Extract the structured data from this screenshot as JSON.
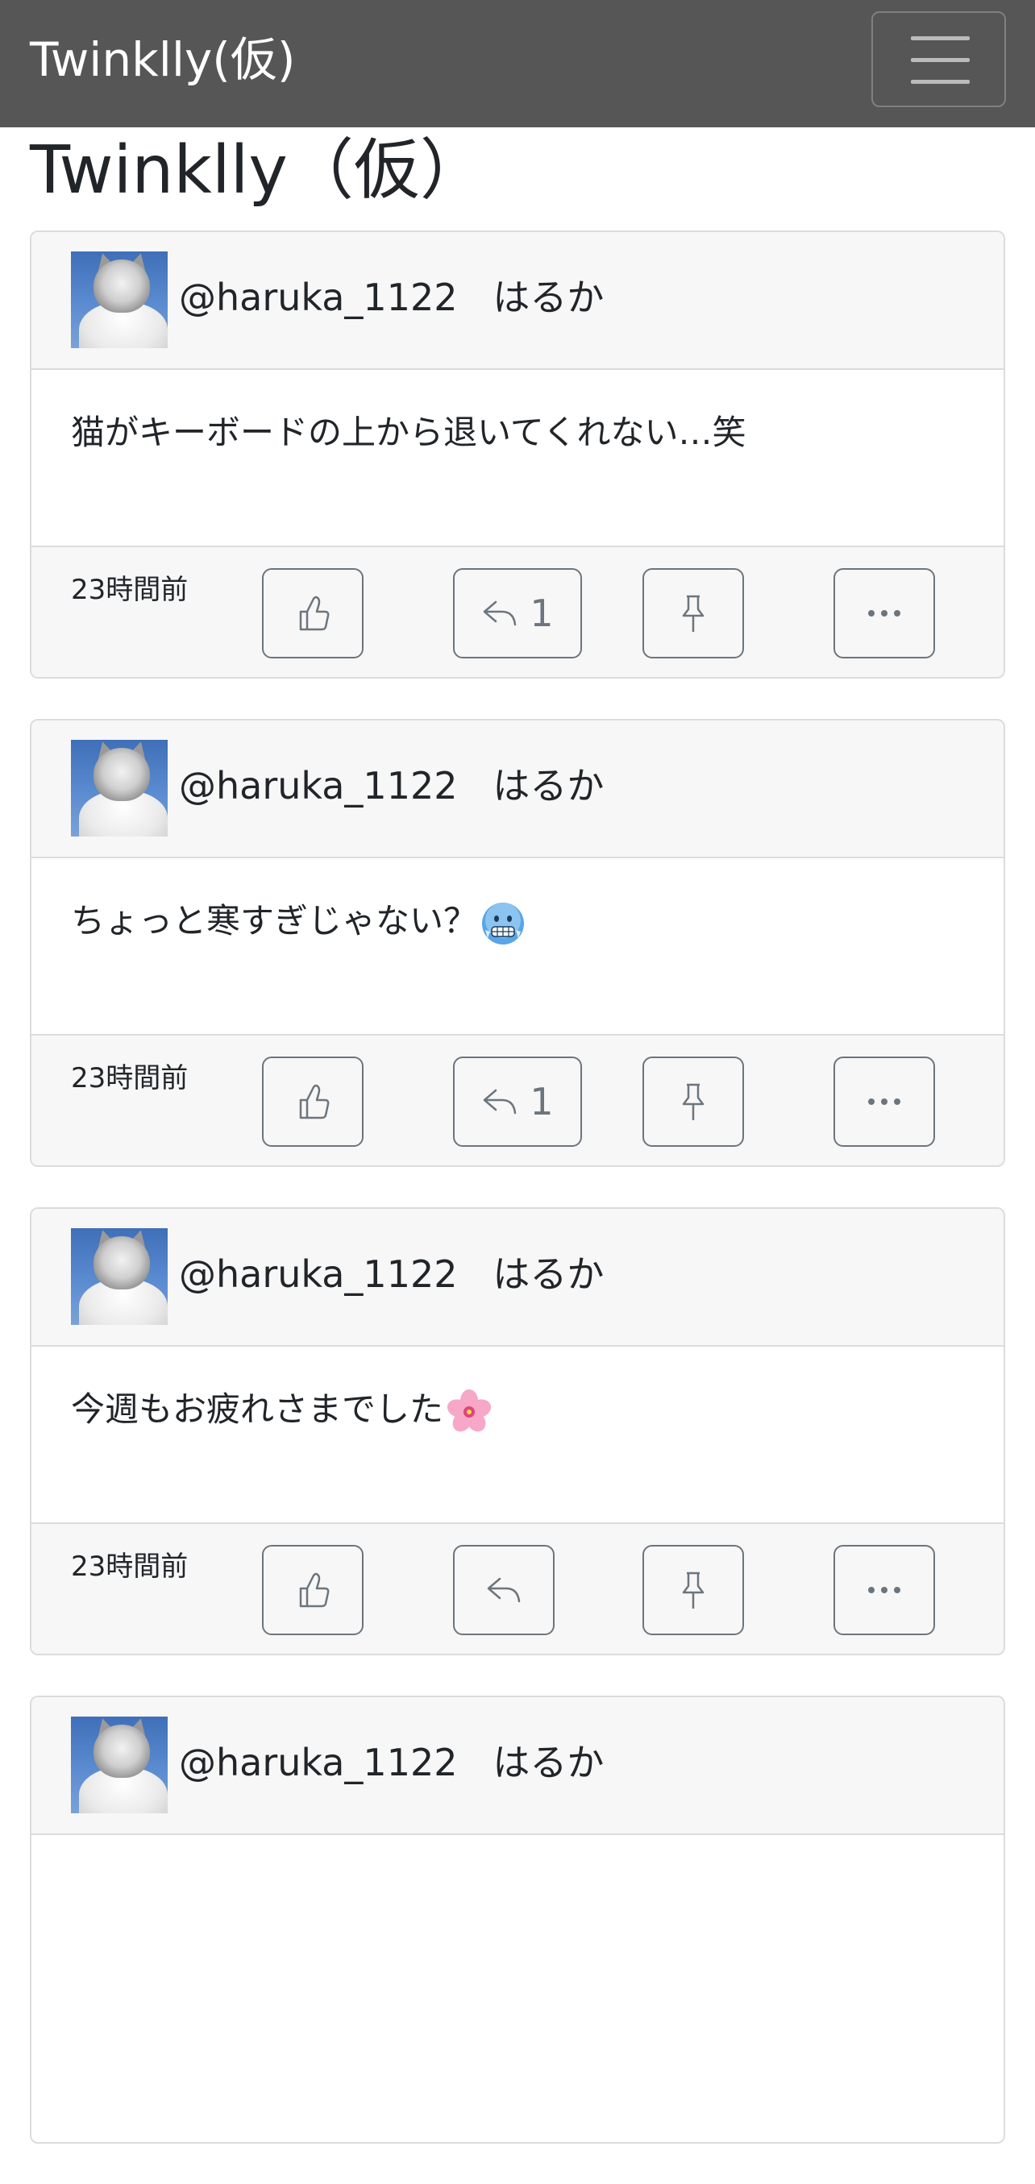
{
  "navbar": {
    "brand": "Twinklly(仮)",
    "toggler_icon": "hamburger-icon"
  },
  "page": {
    "title": "Twinklly（仮）"
  },
  "posts": [
    {
      "username": "@haruka_1122",
      "display_name": "はるか",
      "text": "猫がキーボードの上から退いてくれない…笑",
      "emoji": "",
      "time": "23時間前",
      "reply_count": "1"
    },
    {
      "username": "@haruka_1122",
      "display_name": "はるか",
      "text": "ちょっと寒すぎじゃない？",
      "emoji": "freezing-face-emoji",
      "time": "23時間前",
      "reply_count": "1"
    },
    {
      "username": "@haruka_1122",
      "display_name": "はるか",
      "text": "今週もお疲れさまでした",
      "emoji": "cherry-blossom-emoji",
      "time": "23時間前",
      "reply_count": ""
    },
    {
      "username": "@haruka_1122",
      "display_name": "はるか"
    }
  ],
  "colors": {
    "navbar_bg": "#565656",
    "card_header_bg": "#f7f7f7",
    "button_border": "#6c757d"
  }
}
